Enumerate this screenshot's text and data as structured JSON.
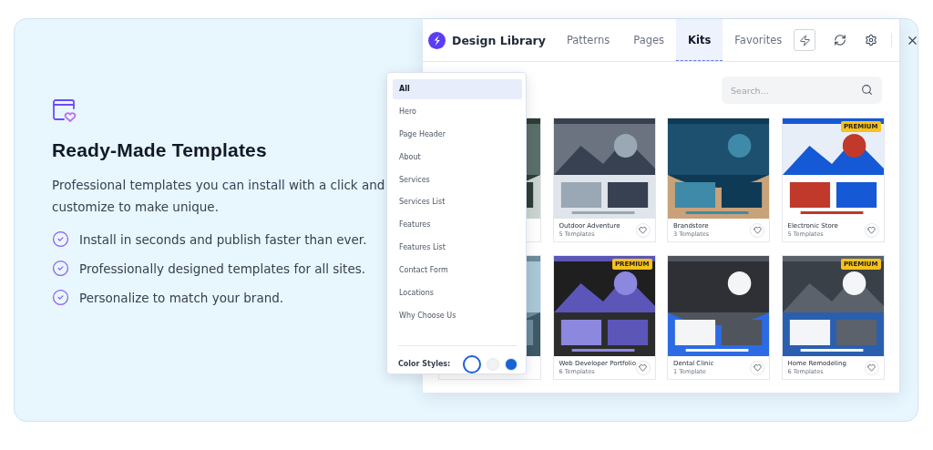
{
  "feature": {
    "title": "Ready-Made Templates",
    "description": "Professional templates you can install with a click and customize to make unique.",
    "bullets": [
      "Install in seconds and publish faster than ever.",
      "Professionally designed templates for all sites.",
      "Personalize to match your brand."
    ]
  },
  "library": {
    "title": "Design Library",
    "tabs": [
      {
        "label": "Patterns",
        "selected": false
      },
      {
        "label": "Pages",
        "selected": false
      },
      {
        "label": "Kits",
        "selected": true
      },
      {
        "label": "Favorites",
        "selected": false
      }
    ],
    "search": {
      "placeholder": "Search..."
    },
    "kits": [
      {
        "kind": "covered"
      },
      {
        "kind": "kit",
        "name": "Outdoor Adventure",
        "count": "5 Templates"
      },
      {
        "kind": "kit",
        "name": "Brandstore",
        "count": "3 Templates"
      },
      {
        "kind": "kit",
        "name": "Electronic Store",
        "count": "5 Templates",
        "badge": "PREMIUM"
      },
      {
        "kind": "covered"
      },
      {
        "kind": "kit",
        "name": "Web Developer Portfolio",
        "count": "6 Templates",
        "badge": "PREMIUM"
      },
      {
        "kind": "kit",
        "name": "Dental Clinic",
        "count": "1 Template"
      },
      {
        "kind": "kit",
        "name": "Home Remodeling",
        "count": "6 Templates",
        "badge": "PREMIUM"
      }
    ],
    "filter": {
      "items": [
        {
          "label": "All",
          "selected": true
        },
        {
          "label": "Hero",
          "selected": false
        },
        {
          "label": "Page Header",
          "selected": false
        },
        {
          "label": "About",
          "selected": false
        },
        {
          "label": "Services",
          "selected": false
        },
        {
          "label": "Services List",
          "selected": false
        },
        {
          "label": "Features",
          "selected": false
        },
        {
          "label": "Features List",
          "selected": false
        },
        {
          "label": "Contact Form",
          "selected": false
        },
        {
          "label": "Locations",
          "selected": false
        },
        {
          "label": "Why Choose Us",
          "selected": false
        }
      ],
      "color_styles_label": "Color Styles:",
      "color_styles": [
        {
          "color": "#ffffff",
          "selected": true
        },
        {
          "color": "#f1f2f4",
          "selected": false
        },
        {
          "color": "#1763d8",
          "selected": false
        }
      ]
    }
  }
}
